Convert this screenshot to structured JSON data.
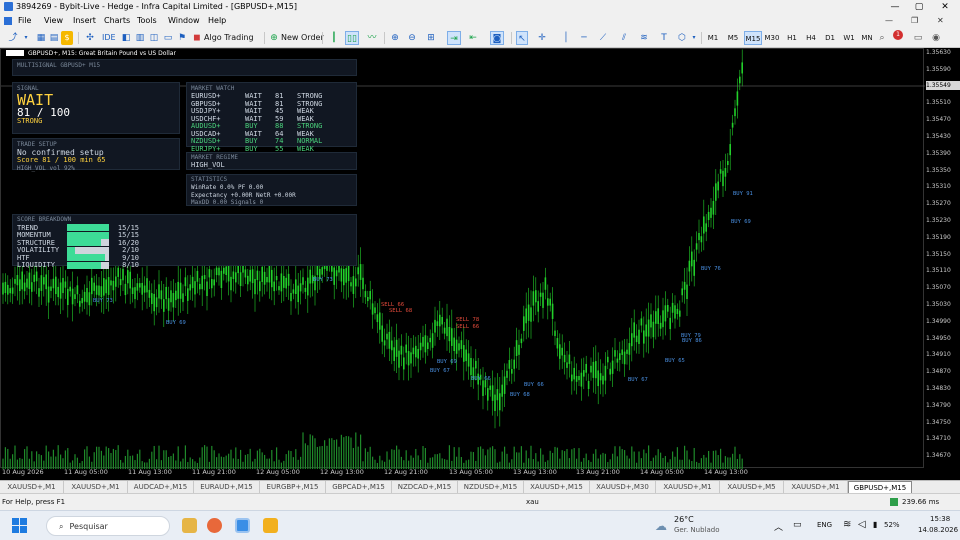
{
  "window": {
    "title": "3894269 - Bybit-Live - Hedge - Infra Capital Limited - [GBPUSD+,M15]",
    "minimize": "—",
    "maximize": "▢",
    "close": "✕"
  },
  "menu": [
    "File",
    "View",
    "Insert",
    "Charts",
    "Tools",
    "Window",
    "Help"
  ],
  "toolbar": {
    "algo_trading": "Algo Trading",
    "new_order": "New Order",
    "ide": "IDE",
    "timeframes": [
      "M1",
      "M5",
      "M15",
      "M30",
      "H1",
      "H4",
      "D1",
      "W1",
      "MN"
    ],
    "active_timeframe": "M15",
    "notification_count": "1"
  },
  "chart": {
    "symbol_title": "GBPUSD+, M15:  Great Britain Pound vs US Dollar",
    "last_price": "1.35549",
    "price_labels": [
      "1.35630",
      "1.35590",
      "1.35550",
      "1.35510",
      "1.35470",
      "1.35430",
      "1.35390",
      "1.35350",
      "1.35310",
      "1.35270",
      "1.35230",
      "1.35190",
      "1.35150",
      "1.35110",
      "1.35070",
      "1.35030",
      "1.34990",
      "1.34950",
      "1.34910",
      "1.34870",
      "1.34830",
      "1.34790",
      "1.34750",
      "1.34710",
      "1.34670"
    ],
    "time_labels": [
      "10 Aug 2026",
      "11 Aug 05:00",
      "11 Aug 13:00",
      "11 Aug 21:00",
      "12 Aug 05:00",
      "12 Aug 13:00",
      "12 Aug 21:00",
      "13 Aug 05:00",
      "13 Aug 13:00",
      "13 Aug 21:00",
      "14 Aug 05:00",
      "14 Aug 13:00"
    ],
    "markers": [
      {
        "text": "BUY 73",
        "color": "#4a90e2"
      },
      {
        "text": "BUY 69",
        "color": "#4a90e2"
      },
      {
        "text": "BUY 73",
        "color": "#4a90e2"
      },
      {
        "text": "SELL 66",
        "color": "#e74c3c"
      },
      {
        "text": "SELL 68",
        "color": "#e74c3c"
      },
      {
        "text": "SELL 78",
        "color": "#e74c3c"
      },
      {
        "text": "SELL 66",
        "color": "#e74c3c"
      },
      {
        "text": "BUY 69",
        "color": "#4a90e2"
      },
      {
        "text": "BUY 67",
        "color": "#4a90e2"
      },
      {
        "text": "BUY 66",
        "color": "#4a90e2"
      },
      {
        "text": "BUY 68",
        "color": "#4a90e2"
      },
      {
        "text": "BUY 66",
        "color": "#4a90e2"
      },
      {
        "text": "BUY 67",
        "color": "#4a90e2"
      },
      {
        "text": "BUY 65",
        "color": "#4a90e2"
      },
      {
        "text": "BUY 79",
        "color": "#4a90e2"
      },
      {
        "text": "BUY 86",
        "color": "#4a90e2"
      },
      {
        "text": "BUY 76",
        "color": "#4a90e2"
      },
      {
        "text": "BUY 69",
        "color": "#4a90e2"
      },
      {
        "text": "BUY 91",
        "color": "#4a90e2"
      }
    ]
  },
  "panel": {
    "header": "MULTISIGNAL   GBPUSD+ M15",
    "signal_title": "SIGNAL",
    "signal_word": "WAIT",
    "signal_score": "81 / 100",
    "signal_strength": "STRONG",
    "setup_title": "TRADE SETUP",
    "setup_line1": "No confirmed setup",
    "setup_line2": "Score 81 / 100   min 65",
    "setup_line3": "HIGH_VOL   vol 92%",
    "watch_title": "MARKET WATCH",
    "watch": [
      {
        "sym": "EURUSD+",
        "act": "WAIT",
        "score": "81",
        "label": "STRONG"
      },
      {
        "sym": "GBPUSD+",
        "act": "WAIT",
        "score": "81",
        "label": "STRONG"
      },
      {
        "sym": "USDJPY+",
        "act": "WAIT",
        "score": "45",
        "label": "WEAK"
      },
      {
        "sym": "USDCHF+",
        "act": "WAIT",
        "score": "59",
        "label": "WEAK"
      },
      {
        "sym": "AUDUSD+",
        "act": "BUY",
        "score": "88",
        "label": "STRONG"
      },
      {
        "sym": "USDCAD+",
        "act": "WAIT",
        "score": "64",
        "label": "WEAK"
      },
      {
        "sym": "NZDUSD+",
        "act": "BUY",
        "score": "74",
        "label": "NORMAL"
      },
      {
        "sym": "EURJPY+",
        "act": "BUY",
        "score": "55",
        "label": "WEAK"
      }
    ],
    "regime_title": "MARKET REGIME",
    "regime": "HIGH_VOL",
    "stats_title": "STATISTICS",
    "stats1": "WinRate 0.0%   PF 0.00",
    "stats2": "Expectancy +0.00R   NetR +0.00R",
    "stats3": "MaxDD 0.00   Signals 0",
    "breakdown_title": "SCORE BREAKDOWN",
    "breakdown": [
      {
        "name": "TREND",
        "value": "15/15",
        "ratio": 1.0
      },
      {
        "name": "MOMENTUM",
        "value": "15/15",
        "ratio": 1.0
      },
      {
        "name": "STRUCTURE",
        "value": "16/20",
        "ratio": 0.8
      },
      {
        "name": "VOLATILITY",
        "value": "2/10",
        "ratio": 0.2
      },
      {
        "name": "HTF",
        "value": "9/10",
        "ratio": 0.9
      },
      {
        "name": "LIQUIDITY",
        "value": "8/10",
        "ratio": 0.8
      }
    ]
  },
  "tabs": [
    "XAUUSD+,M1",
    "XAUUSD+,M1",
    "AUDCAD+,M15",
    "EURAUD+,M15",
    "EURGBP+,M15",
    "GBPCAD+,M15",
    "NZDCAD+,M15",
    "NZDUSD+,M15",
    "XAUUSD+,M15",
    "XAUUSD+,M30",
    "XAUUSD+,M1",
    "XAUUSD+,M5",
    "XAUUSD+,M1",
    "GBPUSD+,M15"
  ],
  "status": {
    "help": "For Help, press F1",
    "input": "xau",
    "ping": "239.66 ms"
  },
  "taskbar": {
    "search": "Pesquisar",
    "weather_temp": "26°C",
    "weather_desc": "Ger. Nublado",
    "lang": "ENG",
    "battery": "52%",
    "time": "15:38",
    "date": "14.08.2026"
  }
}
